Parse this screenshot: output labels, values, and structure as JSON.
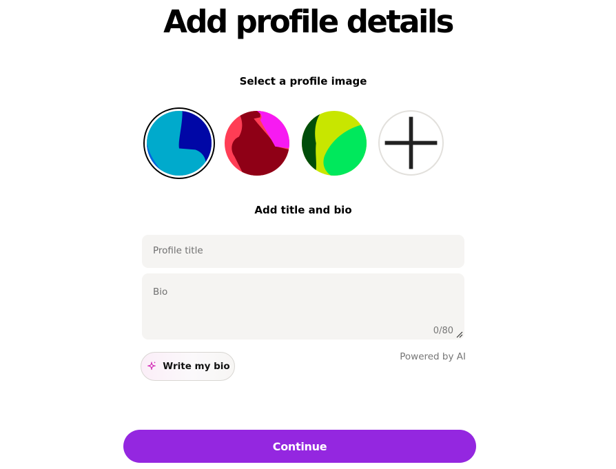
{
  "page": {
    "title": "Add profile details"
  },
  "profile_image": {
    "label": "Select a profile image",
    "options": [
      {
        "name": "avatar-blue",
        "colors": [
          "#00aacc",
          "#0007a6",
          "#0064e0"
        ],
        "selected": true
      },
      {
        "name": "avatar-red",
        "colors": [
          "#ff3d55",
          "#8f0016",
          "#f71af2"
        ],
        "selected": false
      },
      {
        "name": "avatar-green",
        "colors": [
          "#c8e600",
          "#00e85c",
          "#004d0a"
        ],
        "selected": false
      }
    ],
    "add_icon": "plus-icon"
  },
  "bio_section": {
    "label": "Add title and bio",
    "title_placeholder": "Profile title",
    "bio_placeholder": "Bio",
    "counter": "0/80"
  },
  "ai": {
    "write_bio_label": "Write my bio",
    "write_bio_icon": "sparkle-icon",
    "powered_by": "Powered by AI"
  },
  "actions": {
    "continue_label": "Continue"
  },
  "colors": {
    "accent": "#9427e0",
    "field_bg": "#f5f4f2"
  }
}
